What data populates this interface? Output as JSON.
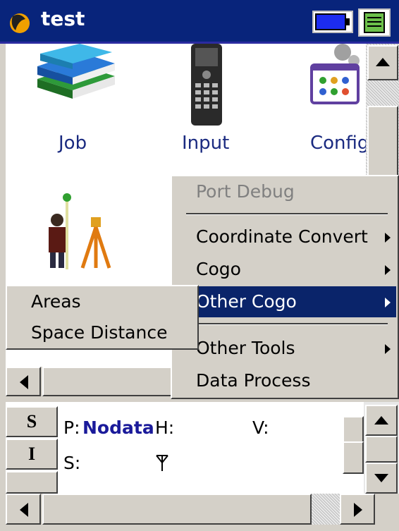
{
  "window": {
    "title": "test"
  },
  "desktop": {
    "items": [
      {
        "label": "Job",
        "icon": "books-icon"
      },
      {
        "label": "Input",
        "icon": "handheld-device-icon"
      },
      {
        "label": "Config",
        "icon": "settings-panel-icon"
      },
      {
        "label": "",
        "icon": "surveyor-icon"
      }
    ]
  },
  "context_menu": {
    "items": [
      {
        "label": "Port Debug",
        "disabled": true
      },
      {
        "label": "Coordinate Convert",
        "submenu": true
      },
      {
        "label": "Cogo",
        "submenu": true
      },
      {
        "label": "Other Cogo",
        "submenu": true,
        "selected": true
      },
      {
        "label": "Other Tools",
        "submenu": true
      },
      {
        "label": "Data Process"
      }
    ]
  },
  "submenu": {
    "items": [
      {
        "label": "Areas"
      },
      {
        "label": "Space Distance"
      }
    ]
  },
  "status_panel": {
    "buttons": [
      "S",
      "I"
    ],
    "p_label": "P:",
    "p_value": "Nodata",
    "h_label": "H:",
    "v_label": "V:",
    "s_label": "S:"
  },
  "colors": {
    "title_bar": "#08247b",
    "menu_highlight": "#0a246a",
    "label_blue": "#1a2a80"
  }
}
